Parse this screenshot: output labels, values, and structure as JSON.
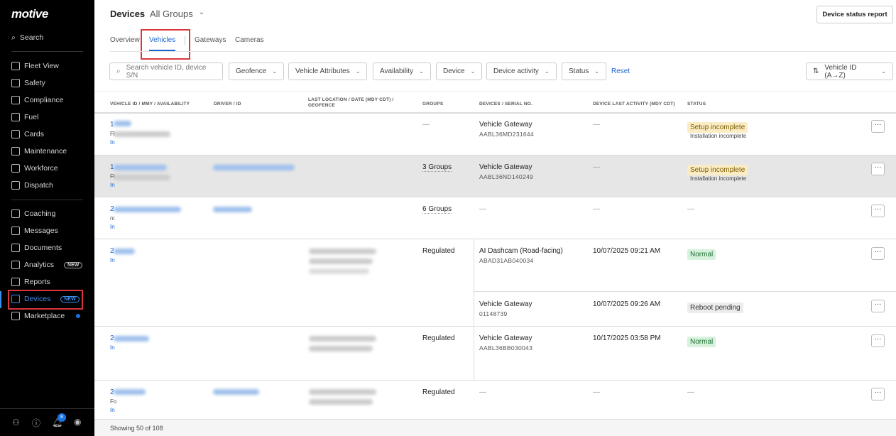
{
  "sidebar": {
    "logo": "motive",
    "search": "Search",
    "items": [
      {
        "label": "Fleet View"
      },
      {
        "label": "Safety"
      },
      {
        "label": "Compliance"
      },
      {
        "label": "Fuel"
      },
      {
        "label": "Cards"
      },
      {
        "label": "Maintenance"
      },
      {
        "label": "Workforce"
      },
      {
        "label": "Dispatch"
      }
    ],
    "items2": [
      {
        "label": "Coaching"
      },
      {
        "label": "Messages"
      },
      {
        "label": "Documents"
      },
      {
        "label": "Analytics",
        "badge": "NEW"
      },
      {
        "label": "Reports"
      },
      {
        "label": "Devices",
        "badge": "NEW"
      },
      {
        "label": "Marketplace"
      }
    ],
    "notification_count": "8"
  },
  "header": {
    "title": "Devices",
    "group": "All Groups",
    "report_button": "Device status report"
  },
  "tabs": [
    "Overview",
    "Vehicles",
    "Gateways",
    "Cameras"
  ],
  "filters": {
    "search_placeholder": "Search vehicle ID, device S/N",
    "geofence": "Geofence",
    "vehicle_attributes": "Vehicle Attributes",
    "availability": "Availability",
    "device": "Device",
    "device_activity": "Device activity",
    "status": "Status",
    "reset": "Reset",
    "sort": "Vehicle ID (A→Z)"
  },
  "columns": [
    "VEHICLE ID / MMY / AVAILABILITY",
    "DRIVER / ID",
    "LAST LOCATION / DATE (MDY CDT) / GEOFENCE",
    "GROUPS",
    "DEVICES / SERIAL NO.",
    "DEVICE LAST ACTIVITY (MDY CDT)",
    "STATUS"
  ],
  "rows": [
    {
      "vid": "1",
      "mmy": "Fl",
      "avail": "In",
      "groups": "—",
      "device": "Vehicle Gateway",
      "serial": "AABL36MD231644",
      "activity": "—",
      "status": "Setup incomplete",
      "status_sub": "Installation incomplete"
    },
    {
      "vid": "1",
      "mmy": "Fl",
      "avail": "In",
      "groups": "3 Groups",
      "device": "Vehicle Gateway",
      "serial": "AABL36ND140249",
      "activity": "—",
      "status": "Setup incomplete",
      "status_sub": "Installation incomplete"
    },
    {
      "vid": "2",
      "mmy": "ni",
      "avail": "In",
      "groups": "6 Groups",
      "device": "—",
      "activity": "—",
      "status": "—"
    },
    {
      "vid": "2",
      "avail": "In",
      "groups": "Regulated",
      "device": "AI Dashcam (Road-facing)",
      "serial": "ABAD31AB040034",
      "activity": "10/07/2025 09:21 AM",
      "status": "Normal",
      "device2": "Vehicle Gateway",
      "serial2": "01148739",
      "activity2": "10/07/2025 09:26 AM",
      "status2": "Reboot pending"
    },
    {
      "vid": "2",
      "avail": "In",
      "groups": "Regulated",
      "device": "Vehicle Gateway",
      "serial": "AABL36BB030043",
      "activity": "10/17/2025 03:58 PM",
      "status": "Normal"
    },
    {
      "vid": "2",
      "mmy": "Fo",
      "avail": "In",
      "groups": "Regulated",
      "device": "—",
      "activity": "—",
      "status": "—"
    }
  ],
  "footer": "Showing 50 of 108"
}
